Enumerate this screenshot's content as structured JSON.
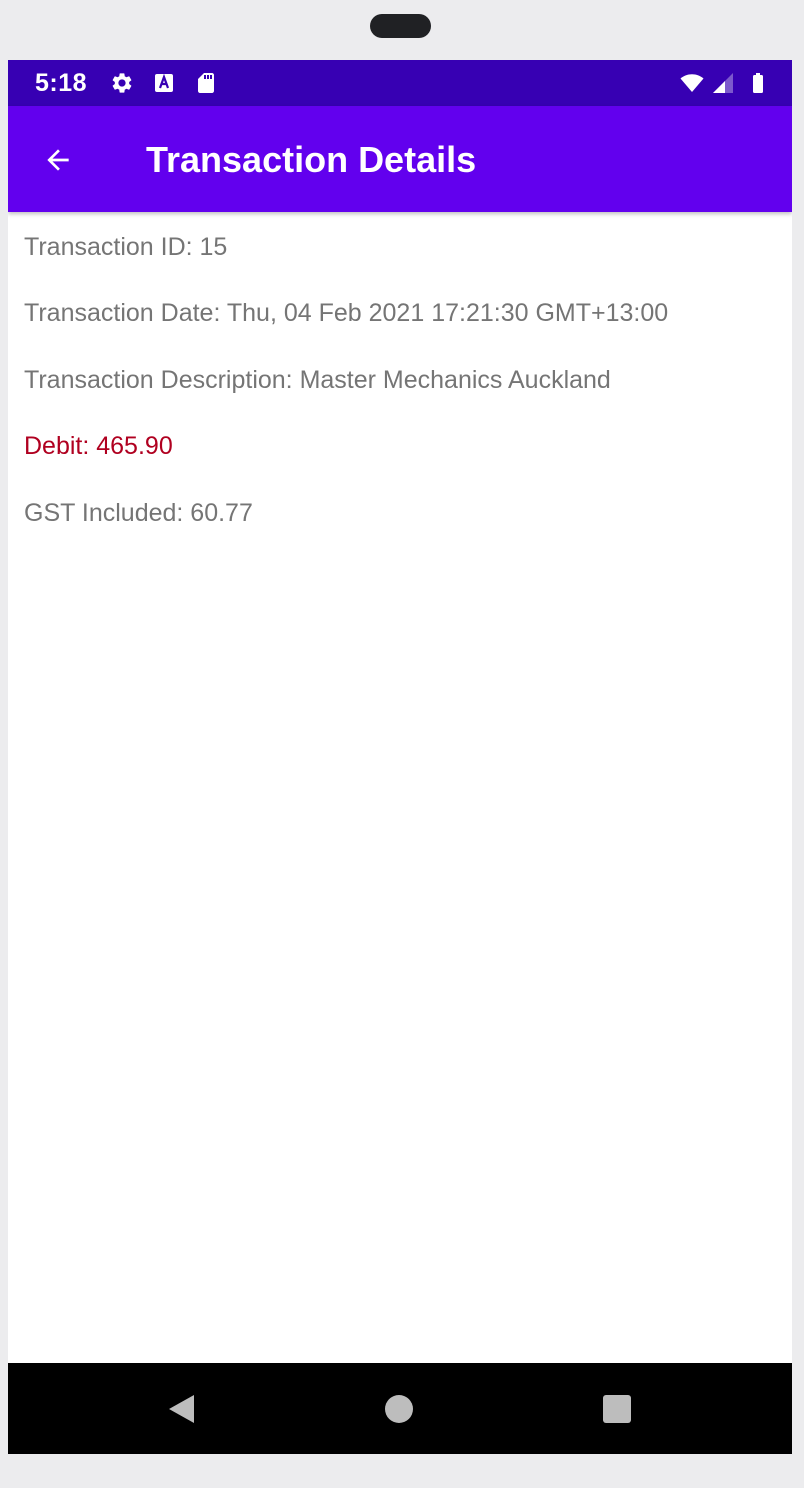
{
  "status_bar": {
    "time": "5:18",
    "left_icons": [
      "gear-icon",
      "font-a-icon",
      "sd-card-icon"
    ],
    "right_icons": [
      "wifi-icon",
      "cell-signal-icon",
      "battery-icon"
    ]
  },
  "app_bar": {
    "title": "Transaction Details",
    "back_icon": "arrow-left-icon",
    "color": "#6200ee",
    "status_color": "#3700b3"
  },
  "details": {
    "transaction_id": "Transaction ID: 15",
    "transaction_date": "Transaction Date: Thu, 04 Feb 2021 17:21:30 GMT+13:00",
    "transaction_description": "Transaction Description: Master Mechanics Auckland",
    "debit": "Debit: 465.90",
    "gst_included": "GST Included: 60.77"
  },
  "colors": {
    "text_secondary": "#757575",
    "debit": "#b00020"
  },
  "nav_bar": {
    "buttons": [
      "back-triangle-icon",
      "home-circle-icon",
      "recents-square-icon"
    ]
  }
}
